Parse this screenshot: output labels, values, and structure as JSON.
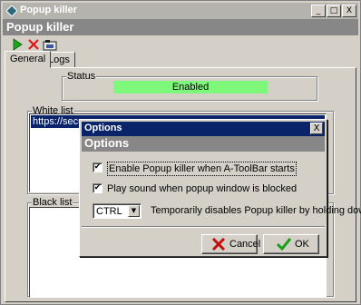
{
  "window": {
    "title": "Popup killer",
    "header": "Popup killer",
    "controls": {
      "minimize": "_",
      "maximize": "□",
      "close": "X"
    }
  },
  "toolbar": {
    "items": [
      {
        "icon": "play-icon",
        "color": "#18a818"
      },
      {
        "icon": "delete-icon",
        "color": "#e01818"
      },
      {
        "icon": "options-icon",
        "color": "#202020"
      }
    ]
  },
  "tabs": [
    {
      "label": "General",
      "active": true
    },
    {
      "label": "Logs",
      "active": false
    }
  ],
  "status": {
    "label": "Status",
    "value": "Enabled",
    "color": "#7ef87a"
  },
  "white_list": {
    "label": "White list",
    "items": [
      "https://secure"
    ]
  },
  "black_list": {
    "label": "Black list",
    "items": []
  },
  "dialog": {
    "title": "Options",
    "header": "Options",
    "close": "X",
    "options": [
      {
        "label": "Enable Popup killer when A-ToolBar starts",
        "checked": true
      },
      {
        "label": "Play sound when popup window is blocked",
        "checked": true
      }
    ],
    "hold_key": {
      "selected": "CTRL",
      "description": "Temporarily disables Popup killer by holding down"
    },
    "buttons": {
      "cancel": "Cancel",
      "ok": "OK"
    }
  },
  "colors": {
    "selection": "#0a246a",
    "header": "#878787",
    "face": "#d4d0c8"
  }
}
